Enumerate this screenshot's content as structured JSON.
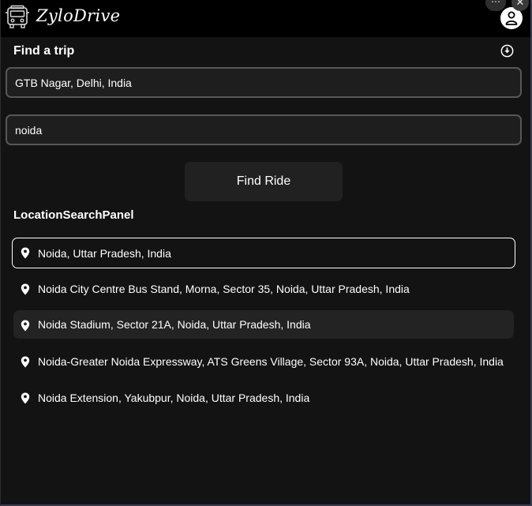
{
  "app": {
    "name": "ZyloDrive"
  },
  "window": {
    "more_label": "⋯",
    "close_label": "✕"
  },
  "trip": {
    "title": "Find a trip",
    "pickup_value": "GTB Nagar, Delhi, India",
    "destination_value": "noida",
    "find_button_label": "Find Ride"
  },
  "panel": {
    "title": "LocationSearchPanel",
    "results": [
      {
        "label": "Noida, Uttar Pradesh, India",
        "state": "selected"
      },
      {
        "label": "Noida City Centre Bus Stand, Morna, Sector 35, Noida, Uttar Pradesh, India",
        "state": "normal"
      },
      {
        "label": "Noida Stadium, Sector 21A, Noida, Uttar Pradesh, India",
        "state": "hovered"
      },
      {
        "label": "Noida-Greater Noida Expressway, ATS Greens Village, Sector 93A, Noida, Uttar Pradesh, India",
        "state": "normal"
      },
      {
        "label": "Noida Extension, Yakubpur, Noida, Uttar Pradesh, India",
        "state": "normal"
      }
    ]
  },
  "icons": {
    "logo": "bus-front-icon",
    "profile": "user-icon",
    "collapse": "arrow-down-circle-icon",
    "result": "map-pin-icon"
  },
  "colors": {
    "background": "#131313",
    "header": "#000000",
    "field_border": "#575757",
    "selected_border": "#ffffff",
    "hover_background": "#232323"
  }
}
